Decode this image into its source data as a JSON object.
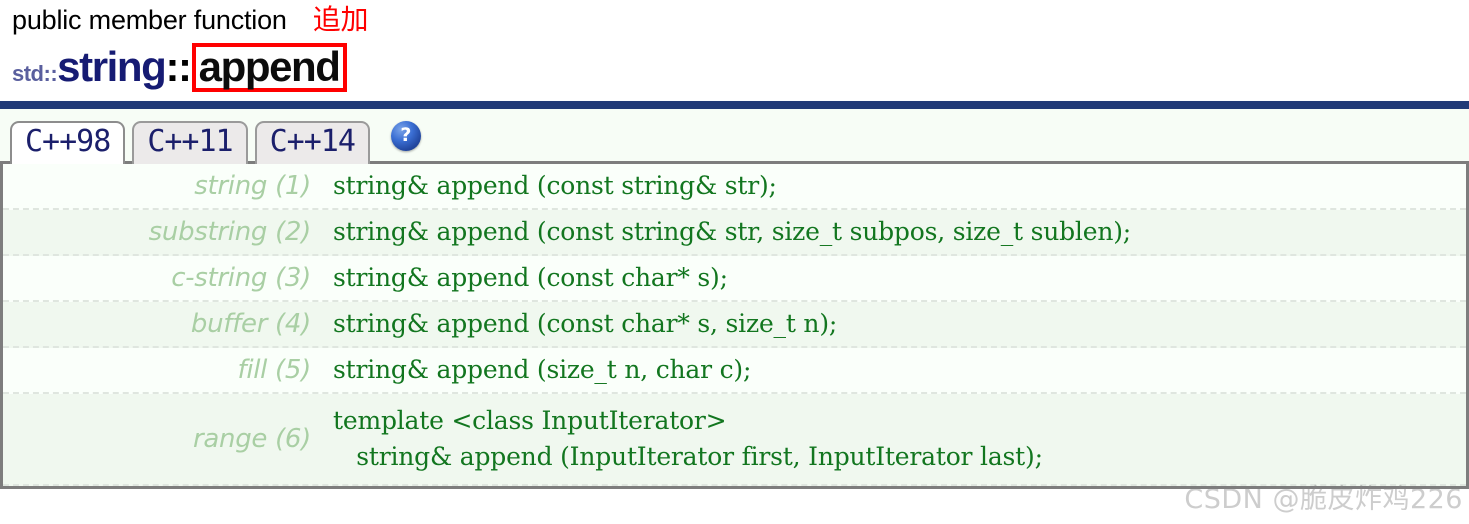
{
  "header": {
    "kind": "public member function",
    "annotation_cjk": "追加",
    "title_namespace": "std::",
    "title_class": "string",
    "title_separator": "::",
    "title_member": "append"
  },
  "tabs": [
    {
      "label": "C++98",
      "active": true
    },
    {
      "label": "C++11",
      "active": false
    },
    {
      "label": "C++14",
      "active": false
    }
  ],
  "help_icon": {
    "glyph": "?",
    "name": "help-icon",
    "color": "#2a5bbf"
  },
  "signatures": [
    {
      "label": "string (1)",
      "code": "string& append (const string& str);"
    },
    {
      "label": "substring (2)",
      "code": "string& append (const string& str, size_t subpos, size_t sublen);"
    },
    {
      "label": "c-string (3)",
      "code": "string& append (const char* s);"
    },
    {
      "label": "buffer (4)",
      "code": "string& append (const char* s, size_t n);"
    },
    {
      "label": "fill (5)",
      "code": "string& append (size_t n, char c);"
    },
    {
      "label": "range (6)",
      "code": "template <class InputIterator>\n   string& append (InputIterator first, InputIterator last);"
    }
  ],
  "watermark": "CSDN @脆皮炸鸡226",
  "colors": {
    "navy_rule": "#213a77",
    "class_name": "#161b73",
    "namespace": "#5a5f9e",
    "annotation_red": "#ff0000",
    "code_green": "#12761f",
    "label_green": "#a9cfa4",
    "row_alt_bg": "#f0f8ef",
    "row_bg": "#fafffa"
  }
}
